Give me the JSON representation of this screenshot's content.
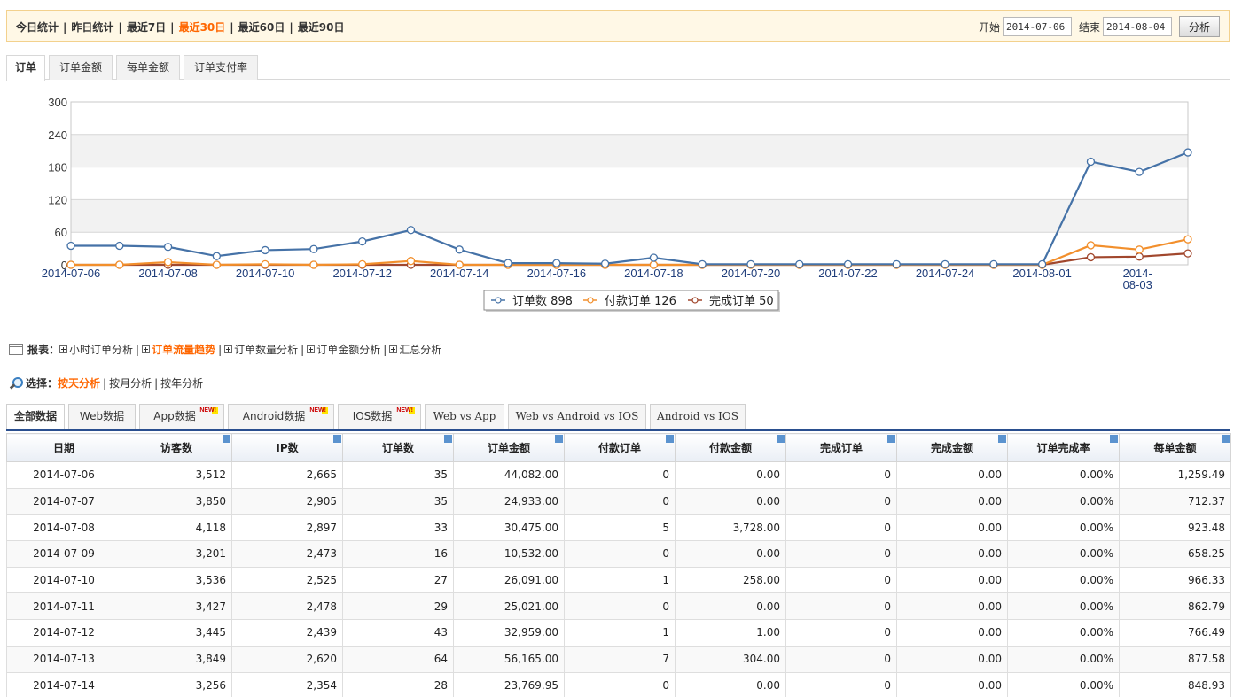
{
  "quick_ranges": [
    {
      "label": "今日统计",
      "active": false
    },
    {
      "label": "昨日统计",
      "active": false
    },
    {
      "label": "最近7日",
      "active": false
    },
    {
      "label": "最近30日",
      "active": true
    },
    {
      "label": "最近60日",
      "active": false
    },
    {
      "label": "最近90日",
      "active": false
    }
  ],
  "date_range": {
    "start_label": "开始",
    "start": "2014-07-06",
    "end_label": "结束",
    "end": "2014-08-04",
    "button": "分析"
  },
  "chart_tabs": [
    {
      "label": "订单",
      "active": true
    },
    {
      "label": "订单金额",
      "active": false
    },
    {
      "label": "每单金额",
      "active": false
    },
    {
      "label": "订单支付率",
      "active": false
    }
  ],
  "chart_data": {
    "type": "line",
    "ylim": [
      0,
      300
    ],
    "yticks": [
      0,
      60,
      120,
      180,
      240,
      300
    ],
    "x": [
      "2014-07-06",
      "2014-07-07",
      "2014-07-08",
      "2014-07-09",
      "2014-07-10",
      "2014-07-11",
      "2014-07-12",
      "2014-07-13",
      "2014-07-14",
      "2014-07-15",
      "2014-07-16",
      "2014-07-17",
      "2014-07-18",
      "2014-07-19",
      "2014-07-20",
      "2014-07-21",
      "2014-07-22",
      "2014-07-23",
      "2014-07-24",
      "2014-07-25",
      "2014-08-01",
      "2014-08-02",
      "2014-08-03",
      "2014-08-04"
    ],
    "xtick_labels": [
      "2014-07-06",
      "2014-07-08",
      "2014-07-10",
      "2014-07-12",
      "2014-07-14",
      "2014-07-16",
      "2014-07-18",
      "2014-07-20",
      "2014-07-22",
      "2014-07-24",
      "2014-08-01",
      "2014-08-03"
    ],
    "series": [
      {
        "name": "订单数",
        "total": "898",
        "color": "#4572a7",
        "values": [
          35,
          35,
          33,
          16,
          27,
          29,
          43,
          64,
          28,
          3,
          3,
          2,
          13,
          1,
          1,
          1,
          1,
          1,
          1,
          1,
          1,
          190,
          171,
          207
        ]
      },
      {
        "name": "付款订单",
        "total": "126",
        "color": "#f28f2c",
        "values": [
          0,
          0,
          5,
          0,
          1,
          0,
          1,
          7,
          0,
          0,
          0,
          0,
          0,
          0,
          0,
          0,
          0,
          0,
          0,
          0,
          0,
          36,
          28,
          47
        ]
      },
      {
        "name": "完成订单",
        "total": "50",
        "color": "#a1472d",
        "values": [
          0,
          0,
          0,
          0,
          0,
          0,
          0,
          0,
          0,
          0,
          0,
          0,
          0,
          0,
          0,
          0,
          0,
          0,
          0,
          0,
          0,
          14,
          15,
          21
        ]
      }
    ],
    "grid": true,
    "legend": "bottom-center"
  },
  "report": {
    "label": "报表：",
    "links": [
      {
        "label": "小时订单分析",
        "active": false
      },
      {
        "label": "订单流量趋势",
        "active": true
      },
      {
        "label": "订单数量分析",
        "active": false
      },
      {
        "label": "订单金额分析",
        "active": false
      },
      {
        "label": "汇总分析",
        "active": false
      }
    ]
  },
  "select": {
    "label": "选择：",
    "links": [
      {
        "label": "按天分析",
        "active": true
      },
      {
        "label": "按月分析",
        "active": false
      },
      {
        "label": "按年分析",
        "active": false
      }
    ]
  },
  "data_tabs": [
    {
      "label": "全部数据",
      "active": true,
      "badge": ""
    },
    {
      "label": "Web数据",
      "active": false,
      "badge": ""
    },
    {
      "label": "App数据",
      "active": false,
      "badge": "NEW!"
    },
    {
      "label": "Android数据",
      "active": false,
      "badge": "NEW!"
    },
    {
      "label": "IOS数据",
      "active": false,
      "badge": "NEW!"
    },
    {
      "label": "Web vs App",
      "active": false,
      "badge": ""
    },
    {
      "label": "Web vs Android vs IOS",
      "active": false,
      "badge": ""
    },
    {
      "label": "Android vs IOS",
      "active": false,
      "badge": ""
    }
  ],
  "table": {
    "columns": [
      "日期",
      "访客数",
      "IP数",
      "订单数",
      "订单金额",
      "付款订单",
      "付款金额",
      "完成订单",
      "完成金额",
      "订单完成率",
      "每单金额"
    ],
    "rows": [
      [
        "2014-07-06",
        "3,512",
        "2,665",
        "35",
        "44,082.00",
        "0",
        "0.00",
        "0",
        "0.00",
        "0.00%",
        "1,259.49"
      ],
      [
        "2014-07-07",
        "3,850",
        "2,905",
        "35",
        "24,933.00",
        "0",
        "0.00",
        "0",
        "0.00",
        "0.00%",
        "712.37"
      ],
      [
        "2014-07-08",
        "4,118",
        "2,897",
        "33",
        "30,475.00",
        "5",
        "3,728.00",
        "0",
        "0.00",
        "0.00%",
        "923.48"
      ],
      [
        "2014-07-09",
        "3,201",
        "2,473",
        "16",
        "10,532.00",
        "0",
        "0.00",
        "0",
        "0.00",
        "0.00%",
        "658.25"
      ],
      [
        "2014-07-10",
        "3,536",
        "2,525",
        "27",
        "26,091.00",
        "1",
        "258.00",
        "0",
        "0.00",
        "0.00%",
        "966.33"
      ],
      [
        "2014-07-11",
        "3,427",
        "2,478",
        "29",
        "25,021.00",
        "0",
        "0.00",
        "0",
        "0.00",
        "0.00%",
        "862.79"
      ],
      [
        "2014-07-12",
        "3,445",
        "2,439",
        "43",
        "32,959.00",
        "1",
        "1.00",
        "0",
        "0.00",
        "0.00%",
        "766.49"
      ],
      [
        "2014-07-13",
        "3,849",
        "2,620",
        "64",
        "56,165.00",
        "7",
        "304.00",
        "0",
        "0.00",
        "0.00%",
        "877.58"
      ],
      [
        "2014-07-14",
        "3,256",
        "2,354",
        "28",
        "23,769.95",
        "0",
        "0.00",
        "0",
        "0.00",
        "0.00%",
        "848.93"
      ]
    ]
  }
}
